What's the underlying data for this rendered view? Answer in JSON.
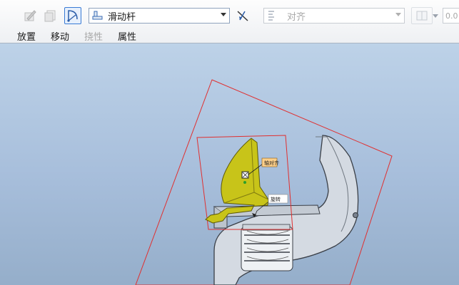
{
  "toolbar": {
    "buttons": [
      {
        "name": "edit-sketch-icon",
        "disabled": true
      },
      {
        "name": "reference-icon",
        "disabled": true
      },
      {
        "name": "sketch-arc-icon",
        "disabled": false,
        "active": true
      }
    ],
    "connection_type": {
      "label": "滑动杆"
    },
    "flip_icon": "flip-direction-icon",
    "constraint": {
      "label": "对齐",
      "disabled": true
    },
    "offset_value": "0.0"
  },
  "tabs": [
    {
      "label": "放置",
      "disabled": false
    },
    {
      "label": "移动",
      "disabled": false
    },
    {
      "label": "挠性",
      "disabled": true
    },
    {
      "label": "属性",
      "disabled": false
    }
  ],
  "viewport": {
    "labels": {
      "axis_label": "轴对齐",
      "surface_label": "旋转"
    },
    "colors": {
      "bounding_box": "#e03030",
      "component": "#c8c419",
      "metal": "#c9d0d8",
      "label_bg": "#ffd08a"
    }
  }
}
